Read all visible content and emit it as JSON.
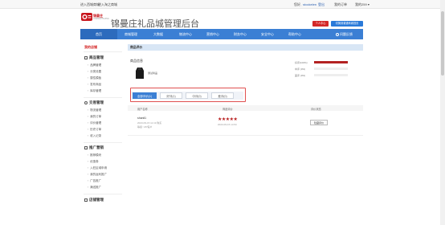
{
  "topbar": {
    "link1": "进入西城商城",
    "link2": "进入淘之商城",
    "greeting": "您好,",
    "username": "stockelen",
    "logout": "登出",
    "my_order": "我的订单",
    "my_store": "我的259 ▾"
  },
  "header": {
    "logo_text": "锦曼庄",
    "logo_sub": "JINMANZHUANG",
    "title": "锦曼庄礼品城管理后台",
    "switch_button": "个人中心",
    "home_button": "切换到普通商城首页"
  },
  "nav": {
    "items": [
      "首页",
      "商城管理",
      "大数据",
      "物流中心",
      "营销中心",
      "财务中心",
      "安全中心",
      "帮助中心"
    ],
    "help": "问题反馈"
  },
  "sidebar": {
    "current": "我的店铺",
    "groups": [
      {
        "label": "商品管理",
        "items": [
          "品牌管理",
          "分类设置",
          "属性模板",
          "发布商品",
          "库存管理"
        ]
      },
      {
        "label": "交易管理",
        "items": [
          "物流管理",
          "我的订单",
          "评价管理",
          "历史订单",
          "收入记录"
        ]
      },
      {
        "label": "推广营销",
        "items": [
          "推荐模块",
          "优惠券",
          "入驻区域申请",
          "我的返利推广",
          "广告推广",
          "满送推广"
        ]
      },
      {
        "label": "店铺管理",
        "items": []
      }
    ]
  },
  "main": {
    "section_title": "商品评价",
    "product_label": "商品信息",
    "product_name": "测试商品",
    "ratings": [
      {
        "label": "好评(100%)",
        "percent": 100
      },
      {
        "label": "中评 (0%)",
        "percent": 0
      },
      {
        "label": "差评 (0%)",
        "percent": 0
      }
    ],
    "tabs": [
      "全部评价(1)",
      "好评(1)",
      "中评(0)",
      "差评(0)"
    ],
    "table_headers": [
      "用户名称",
      "商品评价",
      "评价状态"
    ],
    "review": {
      "user": "shanli1",
      "date": "2023-09-15 11:19 购买",
      "level": "等级: VIP客户",
      "stars": "★★★★★",
      "review_date": "2023-09-15 14:53",
      "action": "隐藏评价"
    }
  },
  "colors": {
    "accent_blue": "#3b7fd4",
    "brand_red": "#c8161d",
    "rating_red": "#b32222"
  }
}
